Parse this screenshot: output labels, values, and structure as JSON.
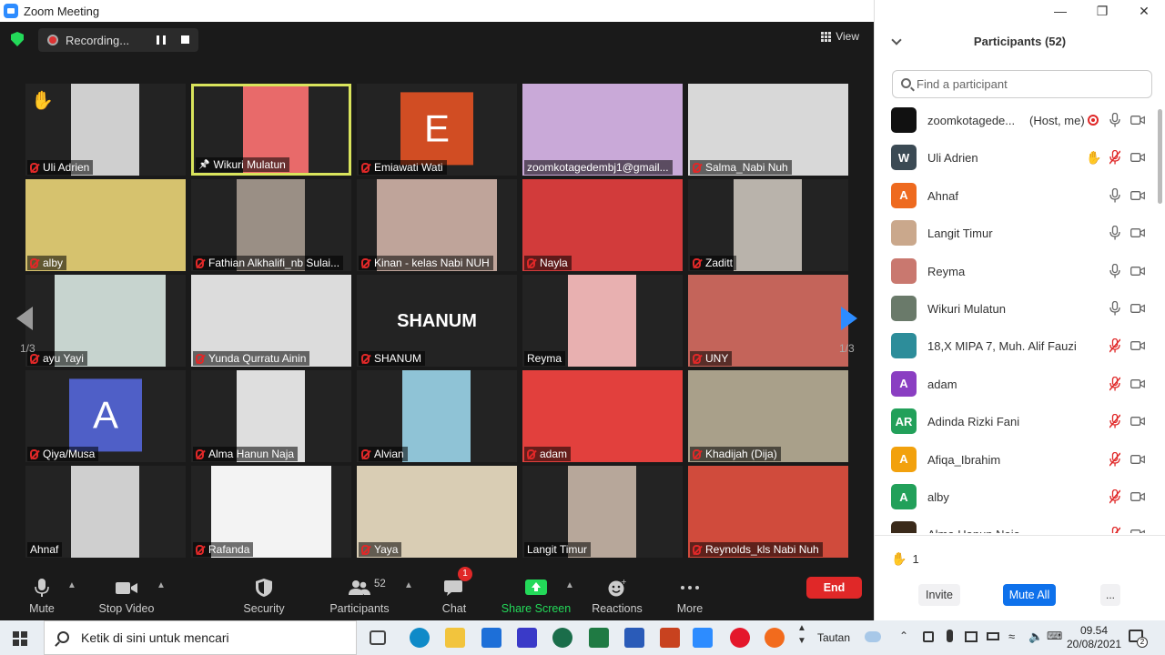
{
  "window": {
    "title": "Zoom Meeting"
  },
  "topbar": {
    "recording_label": "Recording...",
    "view_label": "View"
  },
  "gallery": {
    "page_left": "1/3",
    "page_right": "1/3",
    "tiles": [
      {
        "name": "Uli Adrien",
        "muted": true,
        "hand": true,
        "bg": "#cfcfcf",
        "vx": 50,
        "vw": 75
      },
      {
        "name": "Wikuri Mulatun",
        "muted": false,
        "active": true,
        "pin": true,
        "bg": "#e86a6a",
        "vx": 54,
        "vw": 72
      },
      {
        "name": "Emiawati Wati",
        "muted": true,
        "avatar": "E",
        "avatar_color": "#d14d23",
        "bg": "#232323"
      },
      {
        "name": "zoomkotagedembj1@gmail...",
        "muted": false,
        "bg": "#c9a9d8",
        "vx": 0,
        "vw": 176
      },
      {
        "name": "Salma_Nabi Nuh",
        "muted": true,
        "bg": "#d8d8d8",
        "vx": 0,
        "vw": 176
      },
      {
        "name": "alby",
        "muted": true,
        "bg": "#d6c26e",
        "vx": 0,
        "vw": 176
      },
      {
        "name": "Fathian Alkhalifi_nb Sulai...",
        "muted": true,
        "bg": "#9a8f85",
        "vx": 50,
        "vw": 75
      },
      {
        "name": "Kinan - kelas Nabi NUH",
        "muted": true,
        "bg": "#bfa49a",
        "vx": 22,
        "vw": 132
      },
      {
        "name": "Nayla",
        "muted": true,
        "bg": "#d23b3b",
        "vx": 0,
        "vw": 176
      },
      {
        "name": "Zaditt",
        "muted": true,
        "bg": "#b9b3ab",
        "vx": 50,
        "vw": 75
      },
      {
        "name": "ayu Yayi",
        "muted": true,
        "bg": "#c7d4cf",
        "vx": 32,
        "vw": 122
      },
      {
        "name": "Yunda Qurratu Ainin",
        "muted": true,
        "bg": "#dcdcdc",
        "vx": 0,
        "vw": 176
      },
      {
        "name": "SHANUM",
        "muted": true,
        "text": "SHANUM",
        "bg": "#232323"
      },
      {
        "name": "Reyma",
        "muted": false,
        "bg": "#e8b0b0",
        "vx": 50,
        "vw": 75
      },
      {
        "name": "UNY",
        "muted": true,
        "bg": "#c4645a",
        "vx": 0,
        "vw": 176
      },
      {
        "name": "Qiya/Musa",
        "muted": true,
        "avatar": "A",
        "avatar_color": "#4f5fc7",
        "bg": "#232323"
      },
      {
        "name": "Alma Hanun Naja",
        "muted": true,
        "bg": "#dedede",
        "vx": 50,
        "vw": 75
      },
      {
        "name": "Alvian",
        "muted": true,
        "bg": "#8fc3d6",
        "vx": 50,
        "vw": 75
      },
      {
        "name": "adam",
        "muted": true,
        "bg": "#e2403d",
        "vx": 0,
        "vw": 176
      },
      {
        "name": "Khadijah (Dija)",
        "muted": true,
        "bg": "#a9a08a",
        "vx": 0,
        "vw": 176
      },
      {
        "name": "Ahnaf",
        "muted": false,
        "bg": "#cfcfcf",
        "vx": 50,
        "vw": 75
      },
      {
        "name": "Rafanda",
        "muted": true,
        "bg": "#f3f3f3",
        "vx": 22,
        "vw": 132
      },
      {
        "name": "Yaya",
        "muted": true,
        "bg": "#d9cdb4",
        "vx": 0,
        "vw": 176
      },
      {
        "name": "Langit Timur",
        "muted": false,
        "bg": "#b7a79a",
        "vx": 50,
        "vw": 75
      },
      {
        "name": "Reynolds_kls Nabi Nuh",
        "muted": true,
        "bg": "#d04b3c",
        "vx": 0,
        "vw": 176
      }
    ]
  },
  "toolbar": {
    "mute": "Mute",
    "stop_video": "Stop Video",
    "security": "Security",
    "participants": "Participants",
    "participants_count": "52",
    "chat": "Chat",
    "chat_badge": "1",
    "share_screen": "Share Screen",
    "reactions": "Reactions",
    "more": "More",
    "end": "End"
  },
  "panel": {
    "title": "Participants (52)",
    "search_placeholder": "Find a participant",
    "participants": [
      {
        "name": "zoomkotagede...",
        "role": "(Host, me)",
        "avatar_bg": "#111111",
        "recording": true,
        "mic_on": true
      },
      {
        "name": "Uli Adrien",
        "initial": "W",
        "avatar_bg": "#3b4a54",
        "hand": true,
        "mic_on": false
      },
      {
        "name": "Ahnaf",
        "initial": "A",
        "avatar_bg": "#ee6a1f",
        "mic_on": true
      },
      {
        "name": "Langit Timur",
        "avatar_bg": "#caa88c",
        "mic_on": true
      },
      {
        "name": "Reyma",
        "avatar_bg": "#c9786f",
        "mic_on": true
      },
      {
        "name": "Wikuri Mulatun",
        "avatar_bg": "#6a7a6a",
        "mic_on": true
      },
      {
        "name": "18,X MIPA 7, Muh. Alif Fauzi",
        "avatar_bg": "#2d8d9a",
        "mic_on": false
      },
      {
        "name": "adam",
        "initial": "A",
        "avatar_bg": "#8a3ec2",
        "mic_on": false
      },
      {
        "name": "Adinda Rizki Fani",
        "initial": "AR",
        "avatar_bg": "#22a05a",
        "mic_on": false
      },
      {
        "name": "Afiqa_Ibrahim",
        "initial": "A",
        "avatar_bg": "#f2a10d",
        "mic_on": false
      },
      {
        "name": "alby",
        "initial": "A",
        "avatar_bg": "#22a05a",
        "mic_on": false
      },
      {
        "name": "Alma Hanun Naja",
        "avatar_bg": "#3a2a1a",
        "mic_on": false
      }
    ],
    "raised_hands": "1",
    "invite": "Invite",
    "mute_all": "Mute All",
    "more": "..."
  },
  "taskbar": {
    "search_placeholder": "Ketik di sini untuk mencari",
    "tray_label": "Tautan",
    "time": "09.54",
    "date": "20/08/2021",
    "notifications": "2"
  }
}
